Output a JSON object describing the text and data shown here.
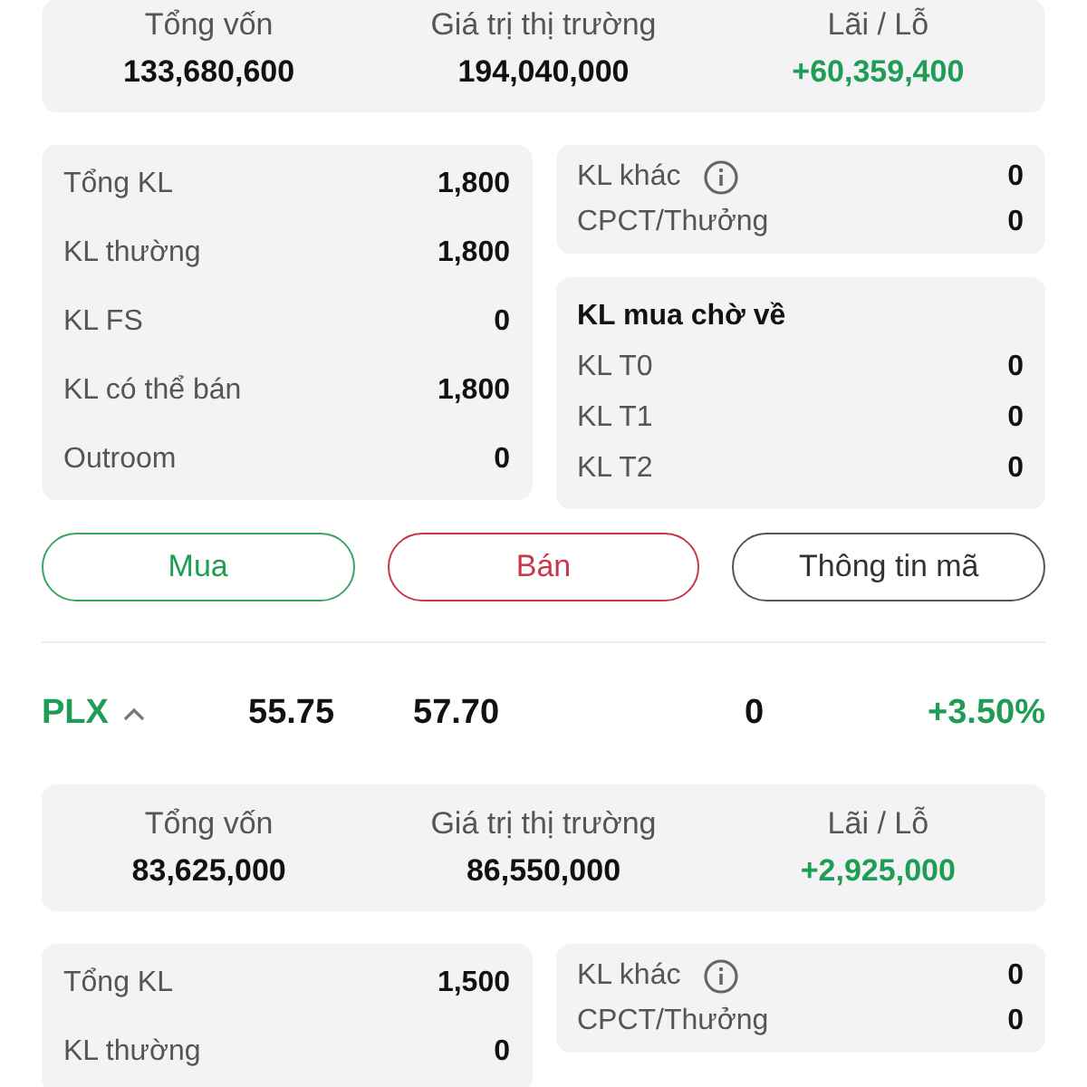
{
  "holdings": [
    {
      "summary": [
        {
          "label": "Tổng vốn",
          "value": "133,680,600",
          "kind": "plain"
        },
        {
          "label": "Giá trị thị trường",
          "value": "194,040,000",
          "kind": "plain"
        },
        {
          "label": "Lãi / Lỗ",
          "value": "+60,359,400",
          "kind": "gain"
        }
      ],
      "volumes": [
        {
          "label": "Tổng KL",
          "value": "1,800"
        },
        {
          "label": "KL thường",
          "value": "1,800"
        },
        {
          "label": "KL FS",
          "value": "0"
        },
        {
          "label": "KL có thể bán",
          "value": "1,800"
        },
        {
          "label": "Outroom",
          "value": "0"
        }
      ],
      "other": [
        {
          "label": "KL khác",
          "value": "0",
          "info": true
        },
        {
          "label": "CPCT/Thưởng",
          "value": "0",
          "info": false
        }
      ],
      "pending": {
        "title": "KL mua chờ về",
        "rows": [
          {
            "label": "KL T0",
            "value": "0"
          },
          {
            "label": "KL T1",
            "value": "0"
          },
          {
            "label": "KL T2",
            "value": "0"
          }
        ]
      },
      "actions": [
        {
          "label": "Mua",
          "kind": "buy"
        },
        {
          "label": "Bán",
          "kind": "sell"
        },
        {
          "label": "Thông tin mã",
          "kind": "info"
        }
      ]
    },
    {
      "header": {
        "symbol": "PLX",
        "expanded": true,
        "cost_price": "55.75",
        "market_price": "57.70",
        "column_4": "0",
        "change": "+3.50%"
      },
      "summary": [
        {
          "label": "Tổng vốn",
          "value": "83,625,000",
          "kind": "plain"
        },
        {
          "label": "Giá trị thị trường",
          "value": "86,550,000",
          "kind": "plain"
        },
        {
          "label": "Lãi / Lỗ",
          "value": "+2,925,000",
          "kind": "gain"
        }
      ],
      "volumes": [
        {
          "label": "Tổng KL",
          "value": "1,500"
        },
        {
          "label": "KL thường",
          "value": "0"
        }
      ],
      "other": [
        {
          "label": "KL khác",
          "value": "0",
          "info": true
        },
        {
          "label": "CPCT/Thưởng",
          "value": "0",
          "info": false
        }
      ]
    }
  ]
}
